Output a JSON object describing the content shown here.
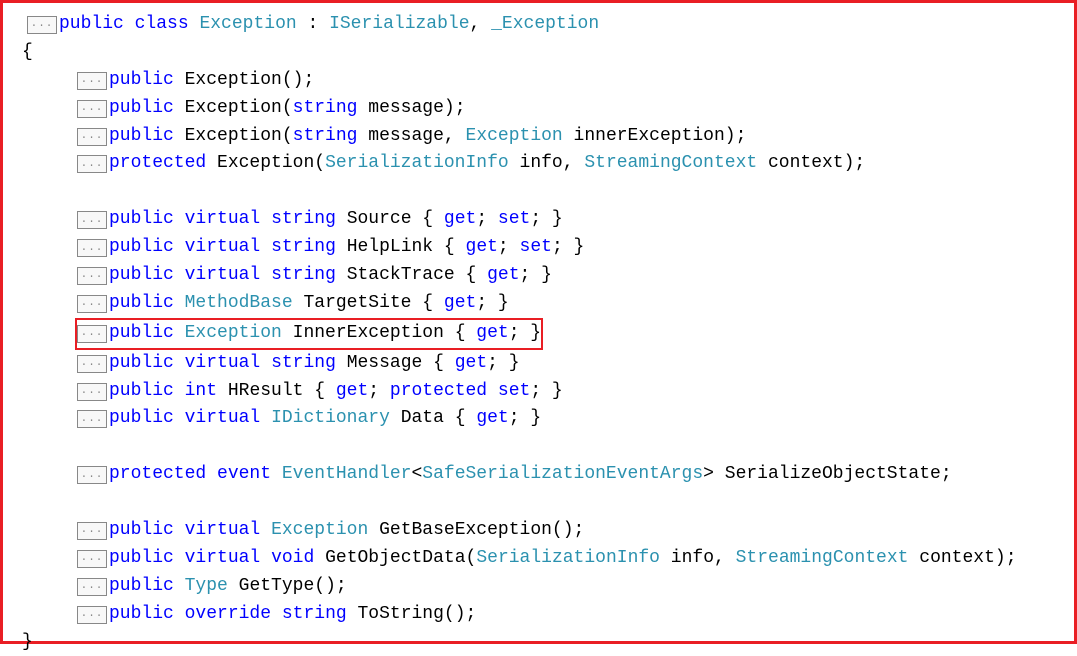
{
  "collapse_label": "...",
  "keywords": {
    "public": "public",
    "protected": "protected",
    "class": "class",
    "virtual": "virtual",
    "string": "string",
    "int": "int",
    "void": "void",
    "event": "event",
    "override": "override",
    "get": "get",
    "set": "set"
  },
  "types": {
    "Exception": "Exception",
    "ISerializable": "ISerializable",
    "_Exception": "_Exception",
    "SerializationInfo": "SerializationInfo",
    "StreamingContext": "StreamingContext",
    "MethodBase": "MethodBase",
    "IDictionary": "IDictionary",
    "EventHandler": "EventHandler",
    "SafeSerializationEventArgs": "SafeSerializationEventArgs",
    "Type": "Type"
  },
  "identifiers": {
    "message": "message",
    "innerException": "innerException",
    "info": "info",
    "context": "context",
    "Source": "Source",
    "HelpLink": "HelpLink",
    "StackTrace": "StackTrace",
    "TargetSite": "TargetSite",
    "InnerException": "InnerException",
    "Message": "Message",
    "HResult": "HResult",
    "Data": "Data",
    "SerializeObjectState": "SerializeObjectState",
    "GetBaseException": "GetBaseException",
    "GetObjectData": "GetObjectData",
    "GetType": "GetType",
    "ToString": "ToString"
  },
  "braces": {
    "open": "{",
    "close": "}"
  }
}
